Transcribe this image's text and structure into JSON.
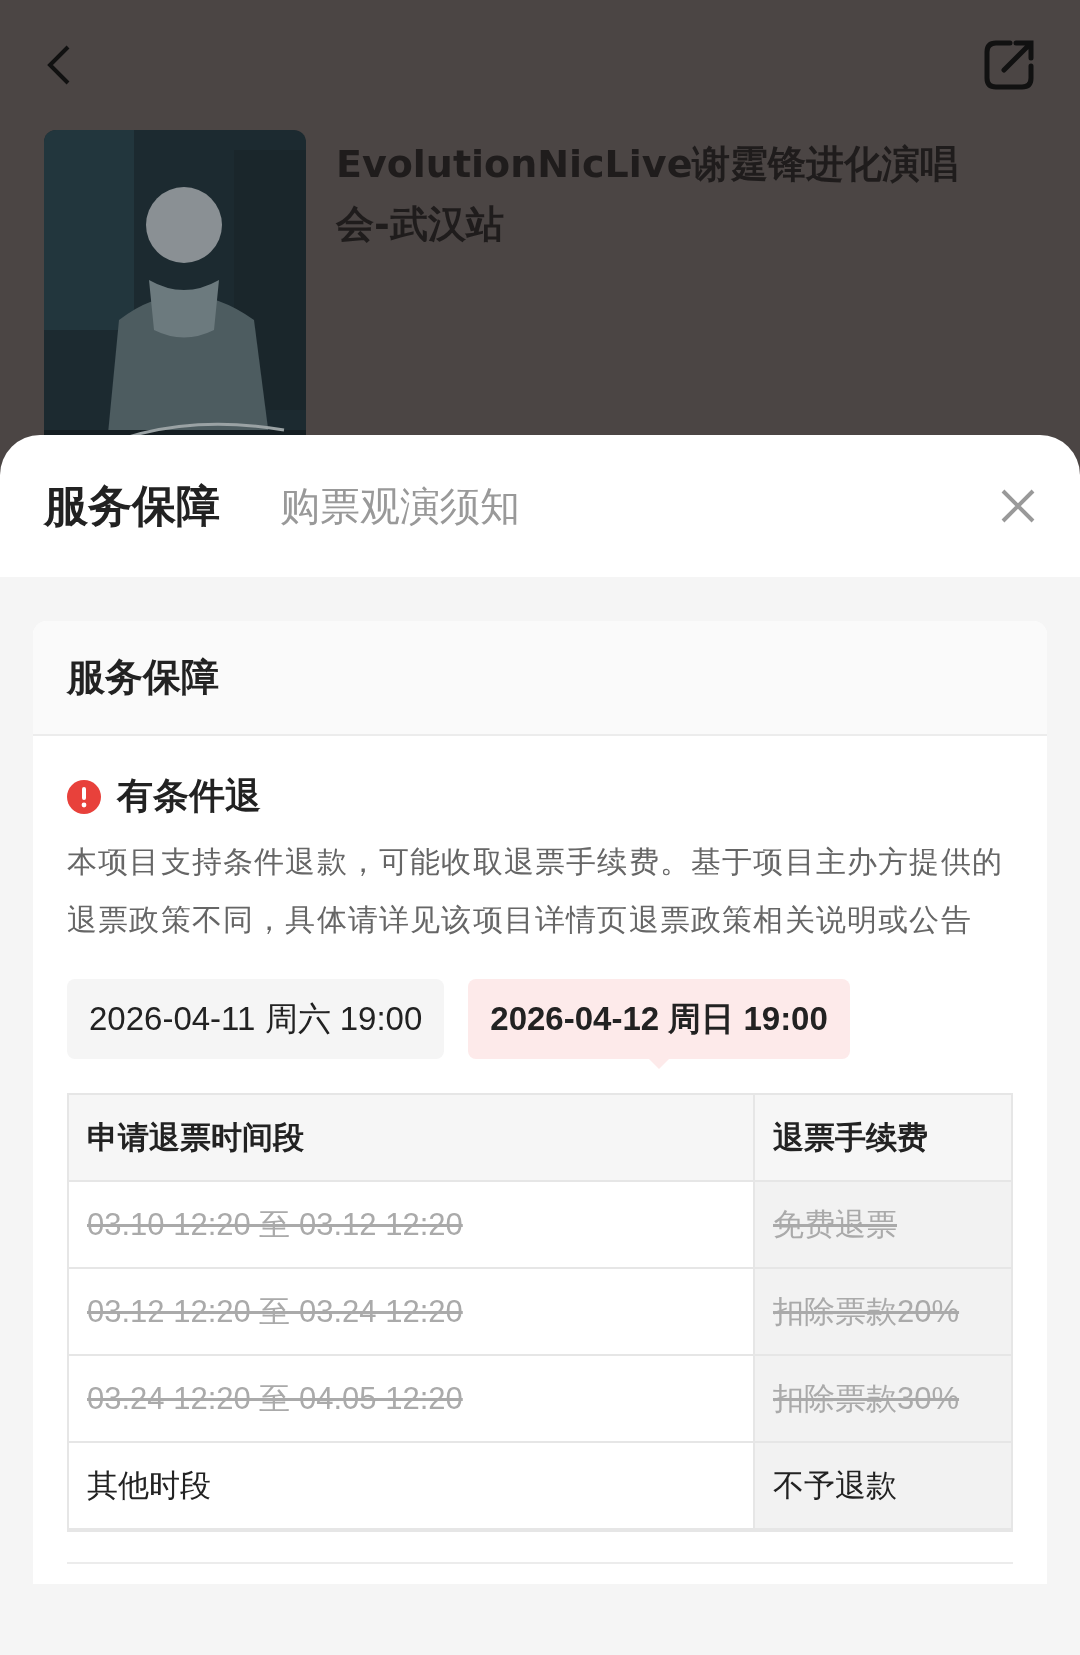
{
  "event": {
    "title": "EvolutionNicLive谢霆锋进化演唱会-武汉站"
  },
  "tabs": [
    {
      "label": "服务保障",
      "selected": true
    },
    {
      "label": "购票观演须知",
      "selected": false
    }
  ],
  "card": {
    "title": "服务保障",
    "policy": {
      "title": "有条件退",
      "description": "本项目支持条件退款，可能收取退票手续费。基于项目主办方提供的退票政策不同，具体请详见该项目详情页退票政策相关说明或公告"
    },
    "dates": [
      {
        "label": "2026-04-11 周六 19:00",
        "selected": false
      },
      {
        "label": "2026-04-12 周日 19:00",
        "selected": true
      }
    ],
    "table": {
      "columns": [
        "申请退票时间段",
        "退票手续费"
      ],
      "rows": [
        {
          "cells": [
            "03.10 12:20 至 03.12 12:20",
            "免费退票"
          ],
          "expired": true
        },
        {
          "cells": [
            "03.12 12:20 至 03.24 12:20",
            "扣除票款20%"
          ],
          "expired": true
        },
        {
          "cells": [
            "03.24 12:20 至 04.05 12:20",
            "扣除票款30%"
          ],
          "expired": true
        },
        {
          "cells": [
            "其他时段",
            "不予退款"
          ],
          "expired": false
        }
      ]
    }
  }
}
